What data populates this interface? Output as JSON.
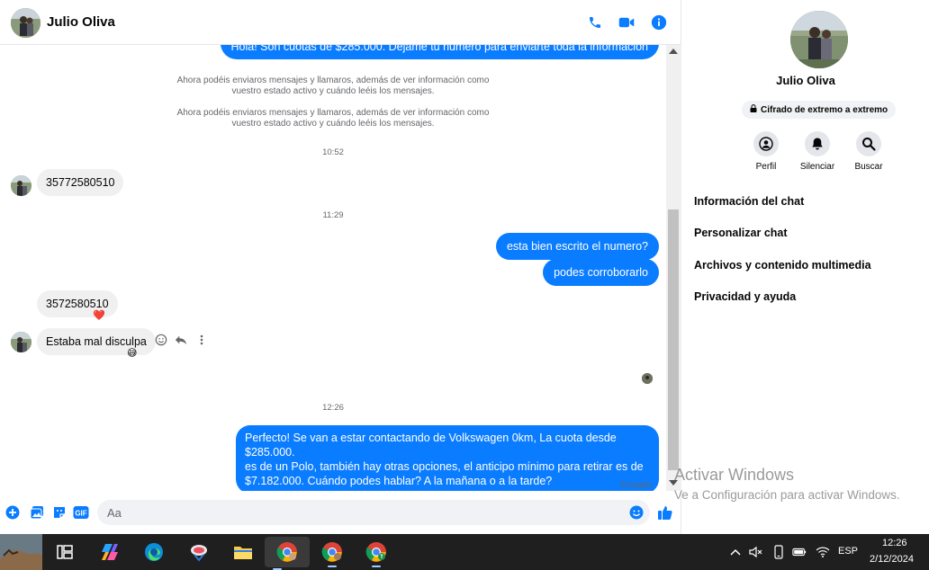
{
  "header": {
    "name": "Julio Oliva"
  },
  "messages": {
    "m1": "Hola! Son cuotas de $285.000. Dejame tu numero para enviarte toda la informacion",
    "sys1_line1": "Ahora podéis enviaros mensajes y llamaros, además de ver información como",
    "sys1_line2": "vuestro estado activo y cuándo leéis los mensajes.",
    "sys2_line1": "Ahora podéis enviaros mensajes y llamaros, además de ver información como",
    "sys2_line2": "vuestro estado activo y cuándo leéis los mensajes.",
    "time1": "10:52",
    "m2": "35772580510",
    "time2": "11:29",
    "m3": "esta bien escrito el numero?",
    "m4": "podes corroborarlo",
    "m5": "3572580510",
    "m5_reaction": "❤️",
    "m6": "Estaba mal disculpa",
    "m6_reaction": "😅",
    "time3": "12:26",
    "m7_line1": "Perfecto!  Se van a estar contactando de Volkswagen 0km, La cuota desde $285.000.",
    "m7_line2": "es de un Polo, también hay otras opciones, el anticipo mínimo para retirar es de",
    "m7_line3": "$7.182.000. Cuándo podes hablar? A la mañana o a la tarde?",
    "status": "Enviado"
  },
  "composer": {
    "placeholder": "Aa"
  },
  "panel": {
    "name": "Julio Oliva",
    "encryption": "Cifrado de extremo a extremo",
    "actions": {
      "profile": "Perfil",
      "mute": "Silenciar",
      "search": "Buscar"
    },
    "items": [
      "Información del chat",
      "Personalizar chat",
      "Archivos y contenido multimedia",
      "Privacidad y ayuda"
    ]
  },
  "watermark": {
    "line1": "Activar Windows",
    "line2": "Ve a Configuración para activar Windows."
  },
  "taskbar": {
    "lang": "ESP",
    "time": "12:26",
    "date": "2/12/2024"
  },
  "colors": {
    "accent": "#0a7cff",
    "taskbar": "#1f1f1f"
  }
}
